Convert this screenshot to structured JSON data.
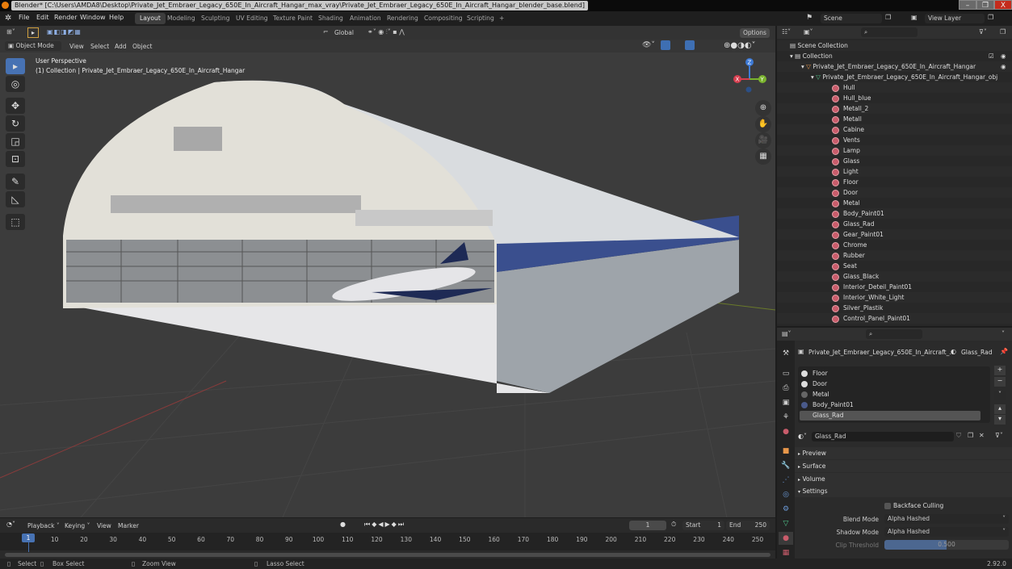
{
  "window": {
    "title": "Blender* [C:\\Users\\AMDA8\\Desktop\\Private_Jet_Embraer_Legacy_650E_In_Aircraft_Hangar_max_vray\\Private_Jet_Embraer_Legacy_650E_In_Aircraft_Hangar_blender_base.blend]",
    "minimize": "–",
    "maximize": "❐",
    "close": "X"
  },
  "menu": [
    "File",
    "Edit",
    "Render",
    "Window",
    "Help"
  ],
  "workspaces": [
    "Layout",
    "Modeling",
    "Sculpting",
    "UV Editing",
    "Texture Paint",
    "Shading",
    "Animation",
    "Rendering",
    "Compositing",
    "Scripting",
    "+"
  ],
  "active_workspace": "Layout",
  "scene": {
    "label": "Scene",
    "view_layer": "View Layer"
  },
  "viewport": {
    "transform_orientation": "Global",
    "options": "Options",
    "mode": "Object Mode",
    "menus": [
      "View",
      "Select",
      "Add",
      "Object"
    ],
    "overlay_title": "User Perspective",
    "overlay_subtitle": "(1) Collection | Private_Jet_Embraer_Legacy_650E_In_Aircraft_Hangar",
    "gizmo": {
      "x": "X",
      "y": "Y",
      "z": "Z"
    },
    "nav_icons": [
      "zoom-icon",
      "hand-pan-icon",
      "camera-icon",
      "grid-ortho-icon"
    ],
    "tools": [
      "select-box-icon",
      "cursor-icon",
      "move-icon",
      "rotate-icon",
      "scale-icon",
      "transform-icon",
      "annotate-icon",
      "measure-icon",
      "add-cube-icon"
    ]
  },
  "outliner": {
    "search_placeholder": "",
    "scene_collection": "Scene Collection",
    "collection": "Collection",
    "object": "Private_Jet_Embraer_Legacy_650E_In_Aircraft_Hangar",
    "mesh": "Private_Jet_Embraer_Legacy_650E_In_Aircraft_Hangar_obj",
    "materials": [
      "Hull",
      "Hull_blue",
      "Metall_2",
      "Metall",
      "Cabine",
      "Vents",
      "Lamp",
      "Glass",
      "Light",
      "Floor",
      "Door",
      "Metal",
      "Body_Paint01",
      "Glass_Rad",
      "Gear_Paint01",
      "Chrome",
      "Rubber",
      "Seat",
      "Glass_Black",
      "Interior_Deteil_Paint01",
      "Interior_White_Light",
      "Silver_Plastik",
      "Control_Panel_Paint01"
    ]
  },
  "properties": {
    "object_name": "Private_Jet_Embraer_Legacy_650E_In_Aircraft_...",
    "material_name": "Glass_Rad",
    "slots": [
      "Floor",
      "Door",
      "Metal",
      "Body_Paint01",
      "Glass_Rad"
    ],
    "active_slot": "Glass_Rad",
    "material_field": "Glass_Rad",
    "panels": [
      "Preview",
      "Surface",
      "Volume",
      "Settings"
    ],
    "settings": {
      "backface_culling": "Backface Culling",
      "blend_mode_label": "Blend Mode",
      "blend_mode": "Alpha Hashed",
      "shadow_mode_label": "Shadow Mode",
      "shadow_mode": "Alpha Hashed",
      "clip_threshold_label": "Clip Threshold",
      "clip_threshold": "0.500",
      "clip_threshold_fraction": 0.5
    }
  },
  "timeline": {
    "menus": [
      "Playback",
      "Keying",
      "View",
      "Marker"
    ],
    "current_frame": "1",
    "start_label": "Start",
    "start": "1",
    "end_label": "End",
    "end": "250",
    "ticks": [
      "1",
      "10",
      "20",
      "30",
      "40",
      "50",
      "60",
      "70",
      "80",
      "90",
      "100",
      "110",
      "120",
      "130",
      "140",
      "150",
      "160",
      "170",
      "180",
      "190",
      "200",
      "210",
      "220",
      "230",
      "240",
      "250"
    ]
  },
  "status": {
    "select": "Select",
    "box_select": "Box Select",
    "zoom_view": "Zoom View",
    "lasso_select": "Lasso Select",
    "version": "2.92.0"
  }
}
